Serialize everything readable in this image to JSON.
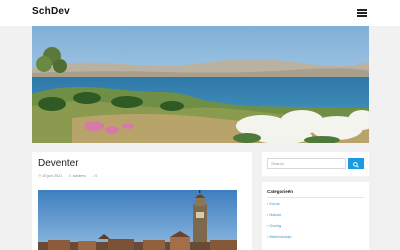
{
  "site": {
    "title": "SchDev"
  },
  "post": {
    "title": "Deventer",
    "date": "20 juni 2021",
    "author": "schdevs",
    "comments": "0"
  },
  "search": {
    "placeholder": "Search"
  },
  "categories": {
    "title": "Categorieën",
    "items": [
      {
        "label": "Kunst"
      },
      {
        "label": "Natuur"
      },
      {
        "label": "Overig"
      },
      {
        "label": "Wetenschap"
      }
    ]
  },
  "colors": {
    "accent": "#1a9ae0",
    "link": "#3a98cf",
    "background": "#f1f1f1"
  },
  "icons": {
    "menu": "hamburger-icon",
    "search": "magnifier-icon",
    "date": "clock-icon",
    "author": "user-icon",
    "comments": "comment-icon"
  }
}
